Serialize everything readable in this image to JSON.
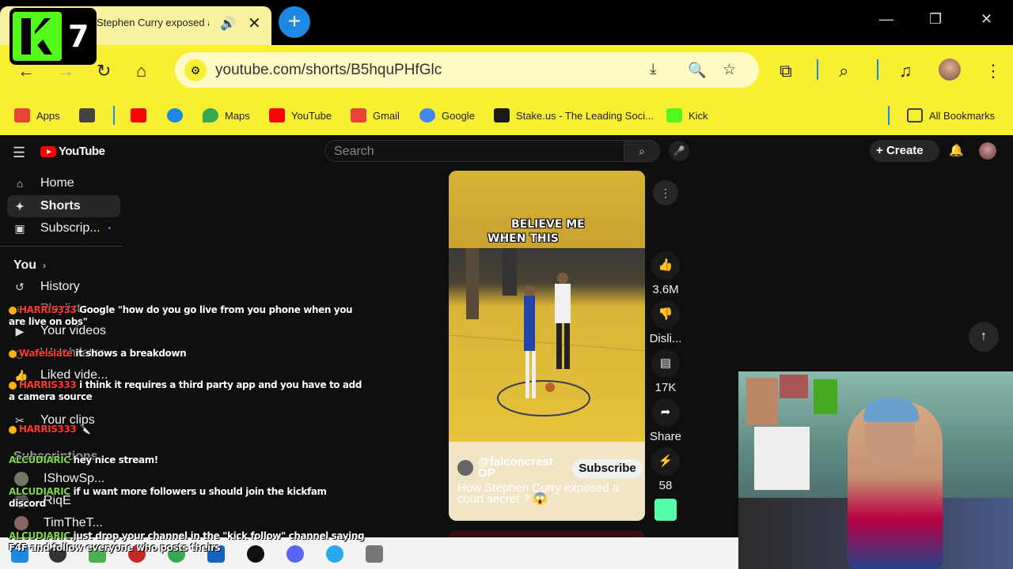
{
  "browser": {
    "tab_title": "Stephen Curry exposed a court",
    "newtab_symbol": "+",
    "url": "youtube.com/shorts/B5hquPHfGlc",
    "overlay_number": "7",
    "window_controls": [
      "—",
      "❐",
      "✕"
    ]
  },
  "bookmarks": {
    "items": [
      {
        "label": "Apps",
        "color": "#ea4335"
      },
      {
        "label": "",
        "color": "#444444"
      },
      {
        "label": "",
        "color": "#ff0000"
      },
      {
        "label": "",
        "color": "#1e88e5"
      },
      {
        "label": "Maps",
        "color": "#34a853"
      },
      {
        "label": "YouTube",
        "color": "#ff0000"
      },
      {
        "label": "Gmail",
        "color": "#ea4335"
      },
      {
        "label": "Google",
        "color": "#4285f4"
      },
      {
        "label": "Stake.us - The Leading Soci...",
        "color": "#1a1a1a"
      },
      {
        "label": "Kick",
        "color": "#53fc18"
      }
    ],
    "all_bookmarks": "All Bookmarks"
  },
  "youtube": {
    "logo": "YouTube",
    "search_placeholder": "Search",
    "create_label": "Create",
    "sidebar": {
      "items": [
        {
          "label": "Home",
          "icon": "⌂"
        },
        {
          "label": "Shorts",
          "icon": "✦"
        },
        {
          "label": "Subscrip...",
          "icon": "▣"
        }
      ],
      "you_heading": "You",
      "you_items": [
        {
          "label": "History",
          "icon": "↺"
        },
        {
          "label": "Playlists",
          "icon": "≡"
        },
        {
          "label": "Your videos",
          "icon": "▶"
        },
        {
          "label": "Watch later",
          "icon": "◷"
        },
        {
          "label": "Liked vide...",
          "icon": "👍"
        },
        {
          "label": "Your clips",
          "icon": "✂"
        }
      ],
      "subscriptions_heading": "Subscriptions",
      "subscriptions": [
        {
          "label": "IShowSp..."
        },
        {
          "label": "RiqE"
        },
        {
          "label": "TimTheT..."
        }
      ]
    },
    "short": {
      "caption_line1": "BELIEVE ME",
      "caption_line2": "WHEN THIS",
      "channel": "@falconcrest OP",
      "subscribe_label": "Subscribe",
      "title": "How Stephen Curry exposed a court secret ? 😱"
    },
    "actions": {
      "likes": "3.6M",
      "dislike": "Disli...",
      "comments": "17K",
      "share": "Share",
      "remix": "58"
    }
  },
  "chat": [
    {
      "user": "HARRIS333",
      "text": "Google \"how do you go live from you phone when you are live on obs\"",
      "green": false
    },
    {
      "user": "Wafelslate",
      "text": "it shows a breakdown",
      "green": false
    },
    {
      "user": "HARRIS333",
      "text": "i think it requires a third party app and you have to add a camera source",
      "green": false
    },
    {
      "user": "HARRIS333",
      "text": "🔪",
      "green": false
    },
    {
      "user": "ALCUDIARIC",
      "text": "hey nice stream!",
      "green": true
    },
    {
      "user": "ALCUDIARIC",
      "text": "if u want more followers u should join the kickfam discord",
      "green": true
    },
    {
      "user": "ALCUDIARIC",
      "text": "just drop your channel in the \"kick follow\" channel saying F4F and follow everyone who posts theirs",
      "green": true
    }
  ]
}
